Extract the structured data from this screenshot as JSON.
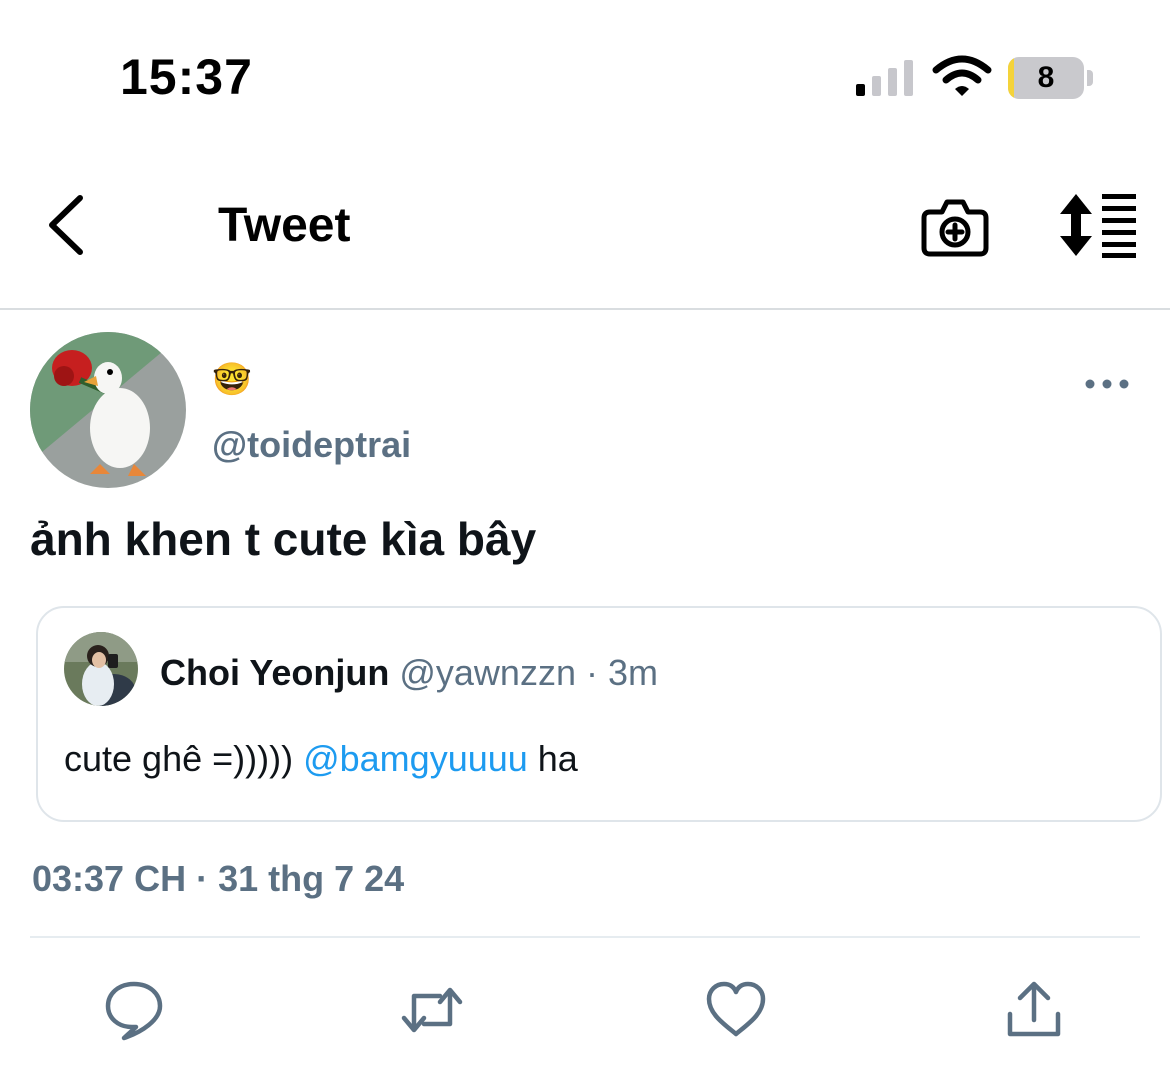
{
  "status_bar": {
    "time": "15:37",
    "battery_level": "8",
    "battery_percent": 8,
    "battery_color": "#f4d33a",
    "signal_bars_active": 1,
    "icons": [
      "cellular-signal-icon",
      "wifi-icon",
      "battery-icon"
    ]
  },
  "nav": {
    "title": "Tweet",
    "icons": [
      "back-chevron-icon",
      "camera-add-icon",
      "sort-timeline-icon"
    ]
  },
  "tweet": {
    "display_name_emoji": "🤓",
    "handle": "@toideptrai",
    "text": "ảnh khen t cute kìa bây",
    "timestamp": "03:37 CH · 31 thg 7 24",
    "more_icon": "more-horizontal-icon"
  },
  "quote": {
    "name": "Choi Yeonjun",
    "handle": "@yawnzzn",
    "separator": "·",
    "time": "3m",
    "text_before": "cute ghê =))))) ",
    "mention": "@bamgyuuuu",
    "text_after": " ha"
  },
  "actions": {
    "icons": [
      "reply-icon",
      "retweet-icon",
      "like-icon",
      "share-icon"
    ]
  },
  "colors": {
    "accent": "#1d9bf0",
    "muted": "#5b7083",
    "text": "#0f1419",
    "border": "#dfe5ea"
  }
}
